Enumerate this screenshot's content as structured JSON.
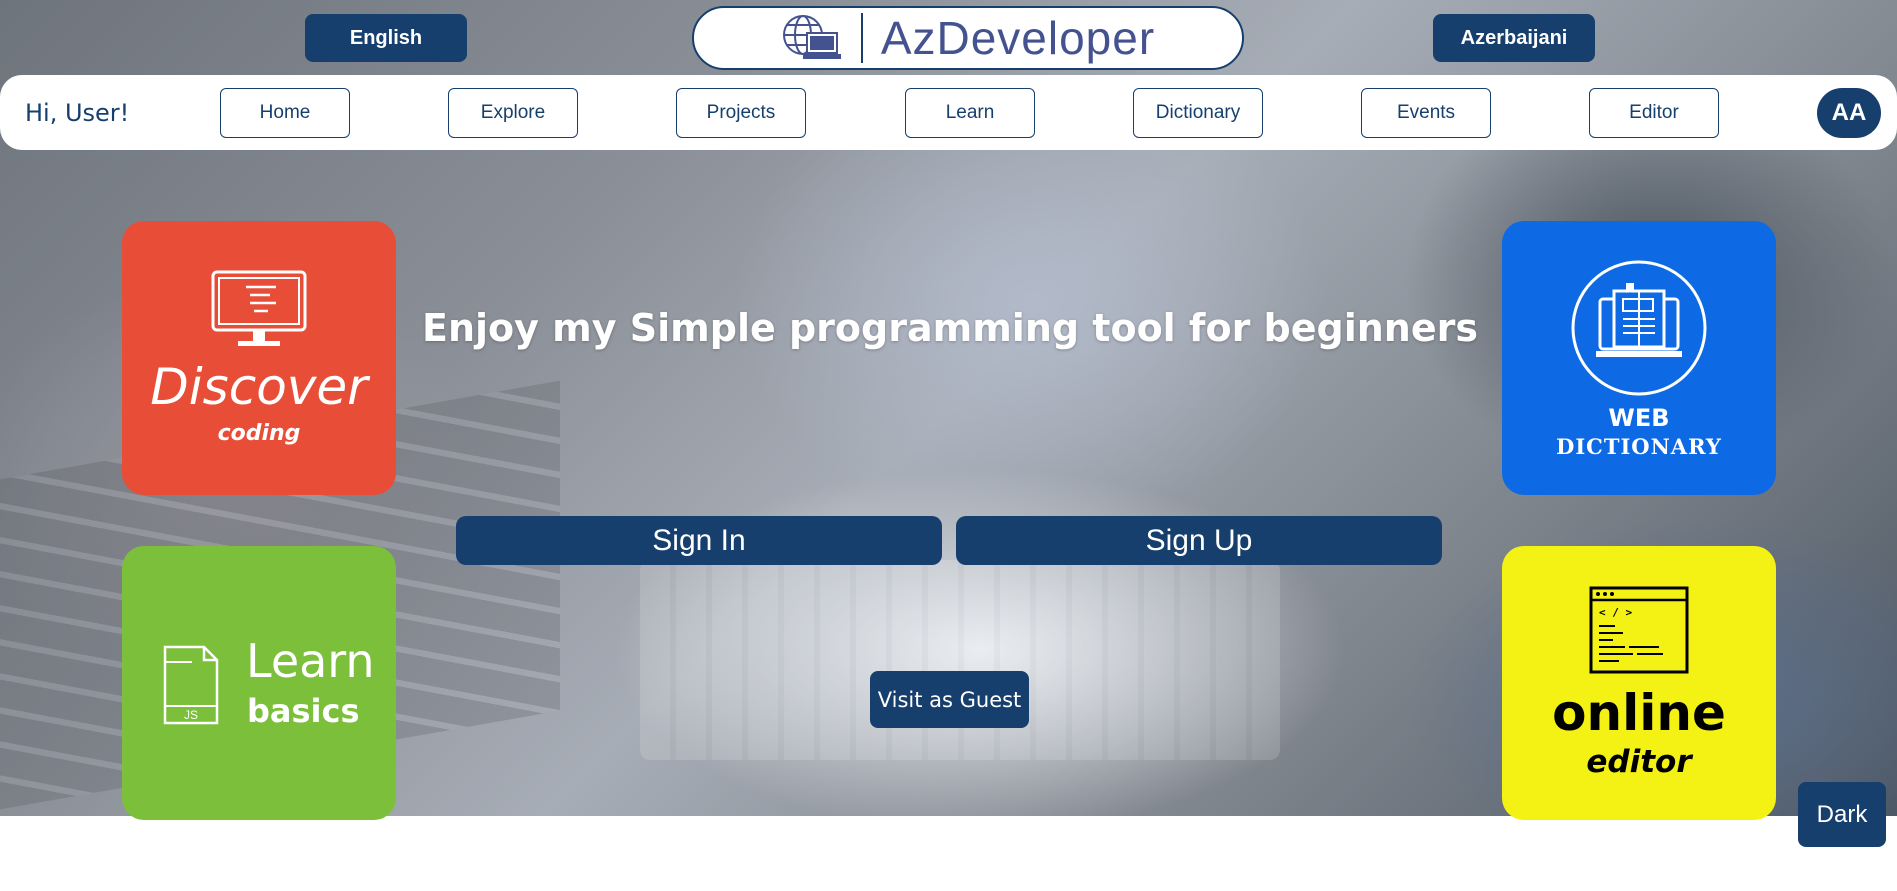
{
  "header": {
    "lang_left": "English",
    "lang_right": "Azerbaijani",
    "logo_text": "AzDeveloper",
    "logo_icon": "globe-laptop-icon"
  },
  "nav": {
    "greeting": "Hi, User!",
    "items": [
      "Home",
      "Explore",
      "Projects",
      "Learn",
      "Dictionary",
      "Events",
      "Editor"
    ],
    "avatar_initials": "AA"
  },
  "tiles": {
    "discover": {
      "title": "Discover",
      "subtitle": "coding",
      "icon": "monitor-icon",
      "color": "#e84e37"
    },
    "learn": {
      "title": "Learn",
      "subtitle": "basics",
      "icon": "js-file-icon",
      "icon_label": "JS",
      "color": "#7bbf3a"
    },
    "dictionary": {
      "line1": "WEB",
      "line2": "DICTIONARY",
      "icon": "book-monitor-icon",
      "color": "#0d6ae4"
    },
    "editor": {
      "title": "online",
      "subtitle": "editor",
      "icon": "code-window-icon",
      "icon_code": "< / >",
      "color": "#f4f214"
    }
  },
  "main": {
    "headline": "Enjoy my Simple programming tool for beginners",
    "sign_in": "Sign In",
    "sign_up": "Sign Up",
    "guest": "Visit as Guest"
  },
  "theme_toggle": "Dark",
  "colors": {
    "primary": "#163f6e",
    "logo_text": "#44538f"
  }
}
